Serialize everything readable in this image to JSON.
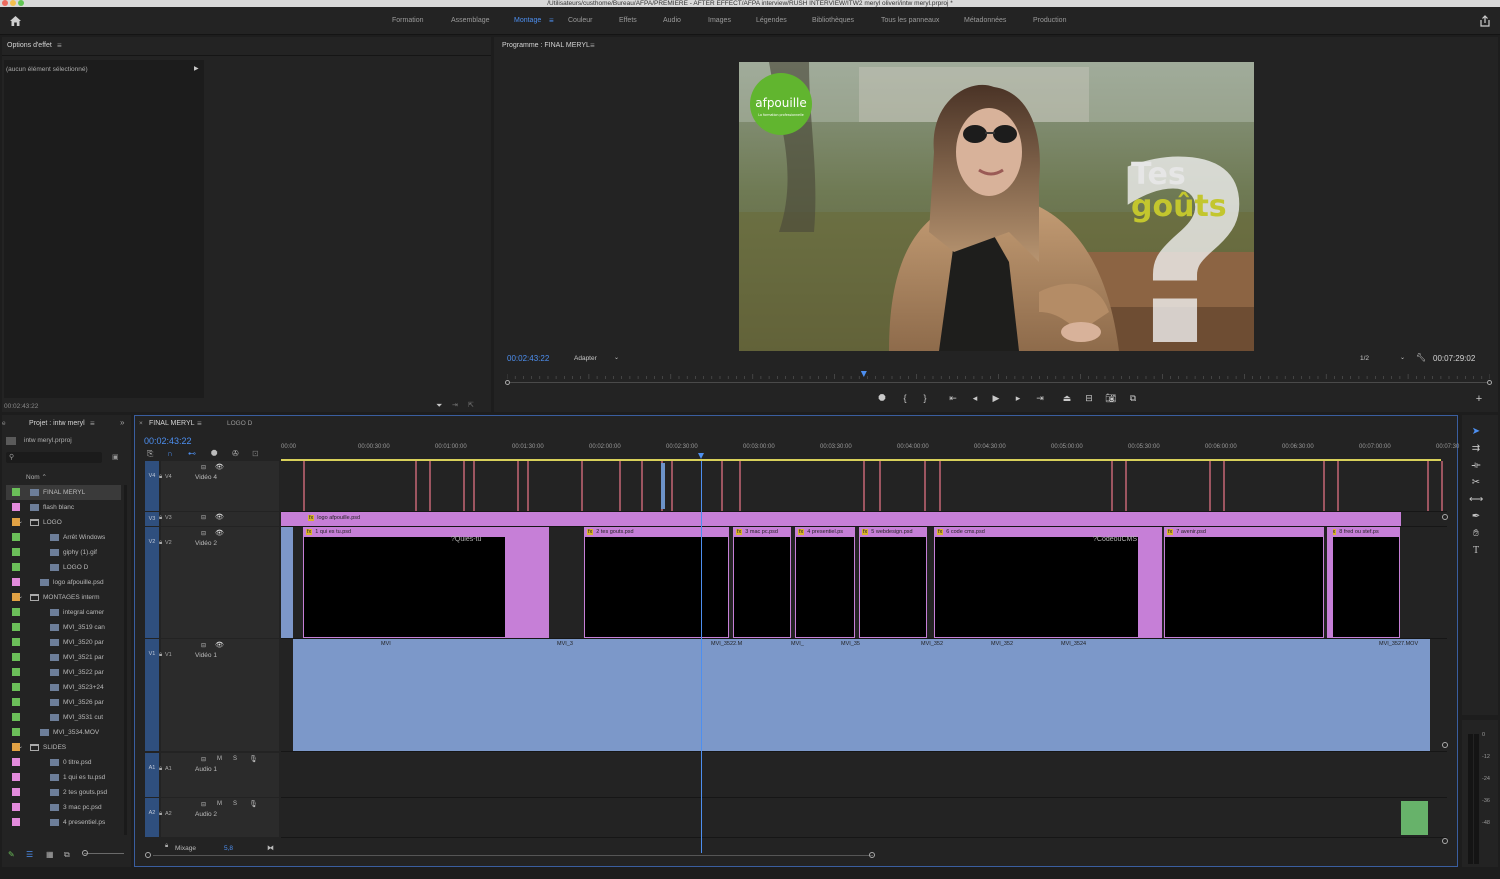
{
  "window": {
    "title": "/Utilisateurs/custhome/Bureau/AFPA/PREMIERE - AFTER EFFECT/AFPA interview/RUSH INTERVIEW/ITW2 meryl oliveri/intw meryl.prproj *"
  },
  "workspaces": {
    "items": [
      "Formation",
      "Assemblage",
      "Montage",
      "Couleur",
      "Effets",
      "Audio",
      "Images",
      "Légendes",
      "Bibliothèques",
      "Tous les panneaux",
      "Métadonnées",
      "Production"
    ],
    "active": "Montage"
  },
  "effect_options": {
    "title": "Options d'effet",
    "no_selection": "(aucun élément sélectionné)",
    "timecode": "00:02:43:22"
  },
  "program_monitor": {
    "title": "Programme : FINAL MERYL",
    "timecode": "00:02:43:22",
    "zoom": "Adapter",
    "resolution": "1/2",
    "duration": "00:07:29:02",
    "playhead_fraction": 0.363,
    "overlay": {
      "logo": "afpouille",
      "logo_tagline": "La formation professionnelle",
      "line1": "Tes",
      "line2": "goûts",
      "mark": "?"
    }
  },
  "project": {
    "tab": "Projet : intw meryl",
    "file": "intw meryl.prproj",
    "column": "Nom",
    "items": [
      {
        "name": "FINAL MERYL",
        "color": "#6bbf59",
        "indent": 0,
        "selected": true
      },
      {
        "name": "flash blanc",
        "color": "#e38bdc",
        "indent": 0
      },
      {
        "name": "LOGO",
        "color": "#e2a244",
        "indent": 0,
        "folder": true
      },
      {
        "name": "Arrêt Windows",
        "color": "#6bbf59",
        "indent": 2
      },
      {
        "name": "giphy (1).gif",
        "color": "#6bbf59",
        "indent": 2
      },
      {
        "name": "LOGO D",
        "color": "#6bbf59",
        "indent": 2
      },
      {
        "name": "logo afpouille.psd",
        "color": "#e38bdc",
        "indent": 1
      },
      {
        "name": "MONTAGES interm",
        "color": "#e2a244",
        "indent": 0,
        "folder": true
      },
      {
        "name": "integral camer",
        "color": "#6bbf59",
        "indent": 2
      },
      {
        "name": "MVI_3519 can",
        "color": "#6bbf59",
        "indent": 2
      },
      {
        "name": "MVI_3520 par",
        "color": "#6bbf59",
        "indent": 2
      },
      {
        "name": "MVI_3521 par",
        "color": "#6bbf59",
        "indent": 2
      },
      {
        "name": "MVI_3522 par",
        "color": "#6bbf59",
        "indent": 2
      },
      {
        "name": "MVI_3523+24",
        "color": "#6bbf59",
        "indent": 2
      },
      {
        "name": "MVI_3526 par",
        "color": "#6bbf59",
        "indent": 2
      },
      {
        "name": "MVI_3531 cut",
        "color": "#6bbf59",
        "indent": 2
      },
      {
        "name": "MVI_3534.MOV",
        "color": "#6bbf59",
        "indent": 1
      },
      {
        "name": "SLIDES",
        "color": "#e2a244",
        "indent": 0,
        "folder": true
      },
      {
        "name": "0 titre.psd",
        "color": "#e38bdc",
        "indent": 2
      },
      {
        "name": "1 qui es tu.psd",
        "color": "#e38bdc",
        "indent": 2
      },
      {
        "name": "2 tes gouts.psd",
        "color": "#e38bdc",
        "indent": 2
      },
      {
        "name": "3 mac pc.psd",
        "color": "#e38bdc",
        "indent": 2
      },
      {
        "name": "4 presentiel.ps",
        "color": "#e38bdc",
        "indent": 2
      }
    ]
  },
  "timeline": {
    "tabs": [
      "FINAL MERYL",
      "LOGO D"
    ],
    "active_tab": "FINAL MERYL",
    "timecode": "00:02:43:22",
    "ruler": [
      "00:00",
      "00:00:30:00",
      "00:01:00:00",
      "00:01:30:00",
      "00:02:00:00",
      "00:02:30:00",
      "00:03:00:00",
      "00:03:30:00",
      "00:04:00:00",
      "00:04:30:00",
      "00:05:00:00",
      "00:05:30:00",
      "00:06:00:00",
      "00:06:30:00",
      "00:07:00:00",
      "00:07:30"
    ],
    "tracks": {
      "v4": {
        "id": "V4",
        "name": "Vidéo 4"
      },
      "v3": {
        "id": "V3",
        "name": ""
      },
      "v2": {
        "id": "V2",
        "name": "Vidéo 2"
      },
      "v1": {
        "id": "V1",
        "name": "Vidéo 1"
      },
      "a1": {
        "id": "A1",
        "name": "Audio 1"
      },
      "a2": {
        "id": "A2",
        "name": "Audio 2"
      }
    },
    "mix_label": "Mixage",
    "mix_value": "5,8",
    "v3_clip": "logo afpouille.psd",
    "v2_clips": [
      "1 qui es tu.psd",
      "2 tes gouts.psd",
      "3 mac pc.psd",
      "4 presentiel.ps",
      "5 webdesign.psd",
      "6 code cms.psd",
      "7 avenir.psd",
      "8 fred ou stef.ps"
    ],
    "v2_slide_a": {
      "line1": "Qui",
      "line2": "es-tu",
      "mark": "?"
    },
    "v2_slide_b": {
      "line1": "Code",
      "line2": "ou",
      "line3": "CMS",
      "mark": "?"
    },
    "v1_labels": [
      "MVI",
      "MVI_3",
      "MVI_3522.M",
      "MVI_",
      "MVI_35",
      "MVI_352",
      "MVI_352",
      "MVI_3524",
      "MVI_3527.MOV"
    ]
  },
  "meter": {
    "scale": [
      "0",
      "-12",
      "-24",
      "-36",
      "-48"
    ]
  }
}
